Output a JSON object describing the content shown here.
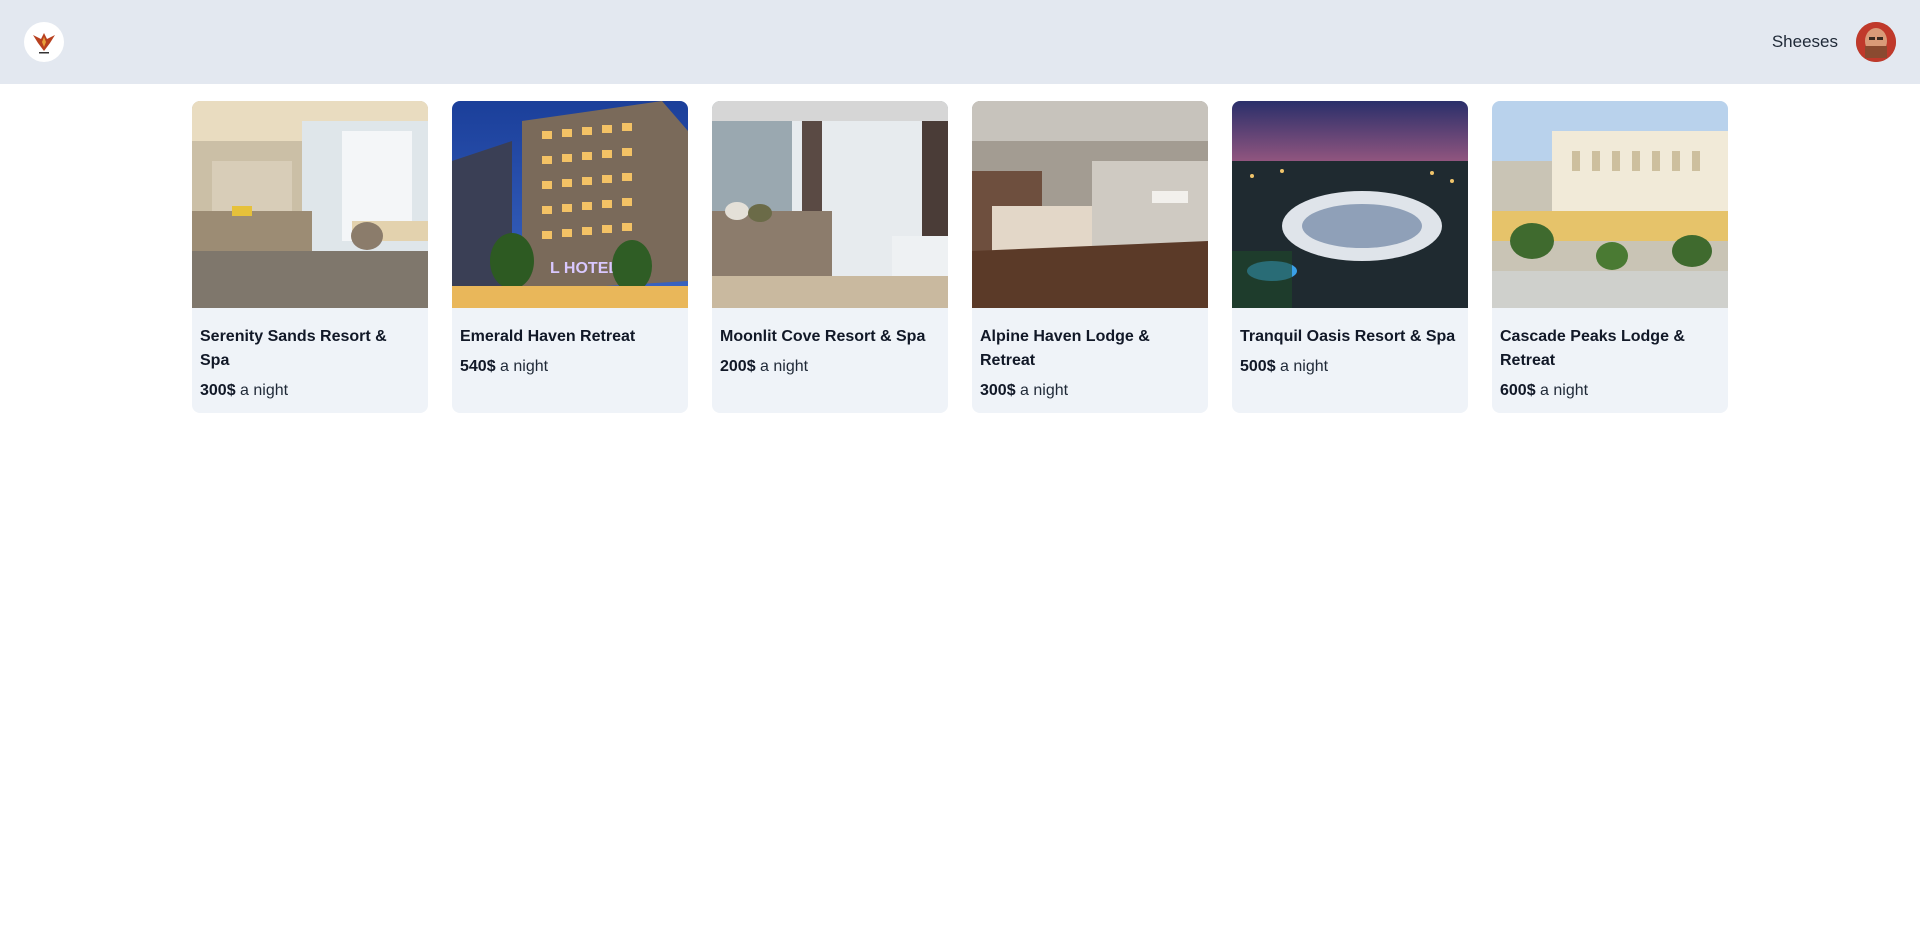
{
  "header": {
    "logo_icon": "phoenix-logo-icon",
    "username": "Sheeses"
  },
  "listings": [
    {
      "name": "Serenity Sands Resort & Spa",
      "price": "300$",
      "unit": "a night",
      "image": "hotel-room-bedroom"
    },
    {
      "name": "Emerald Haven Retreat",
      "price": "540$",
      "unit": "a night",
      "image": "hotel-building-night"
    },
    {
      "name": "Moonlit Cove Resort & Spa",
      "price": "200$",
      "unit": "a night",
      "image": "hotel-room-window"
    },
    {
      "name": "Alpine Haven Lodge & Retreat",
      "price": "300$",
      "unit": "a night",
      "image": "hotel-room-wood-floor"
    },
    {
      "name": "Tranquil Oasis Resort & Spa",
      "price": "500$",
      "unit": "a night",
      "image": "resort-aerial-sunset"
    },
    {
      "name": "Cascade Peaks Lodge & Retreat",
      "price": "600$",
      "unit": "a night",
      "image": "classical-palace-hotel"
    }
  ]
}
